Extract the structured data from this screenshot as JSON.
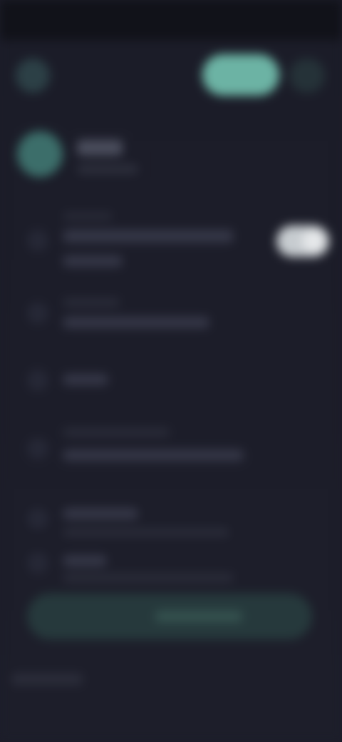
{
  "status_bar": {
    "time": "",
    "icons": ""
  },
  "header": {
    "primary_button_label": "",
    "more_button_label": ""
  },
  "profile": {
    "name": "",
    "subtitle": ""
  },
  "rows": [
    {
      "title": "",
      "subtitle": "",
      "toggle_on": true
    },
    {
      "title": "",
      "subtitle": ""
    },
    {
      "title": ""
    },
    {
      "title": "",
      "subtitle": ""
    },
    {
      "title": "",
      "subtitle": ""
    },
    {
      "title": "",
      "subtitle": ""
    }
  ],
  "cta": {
    "label": ""
  },
  "footer": {
    "text": ""
  },
  "colors": {
    "background": "#1c1d29",
    "accent": "#6cb3a4",
    "toggle": "#c7ccd0"
  }
}
